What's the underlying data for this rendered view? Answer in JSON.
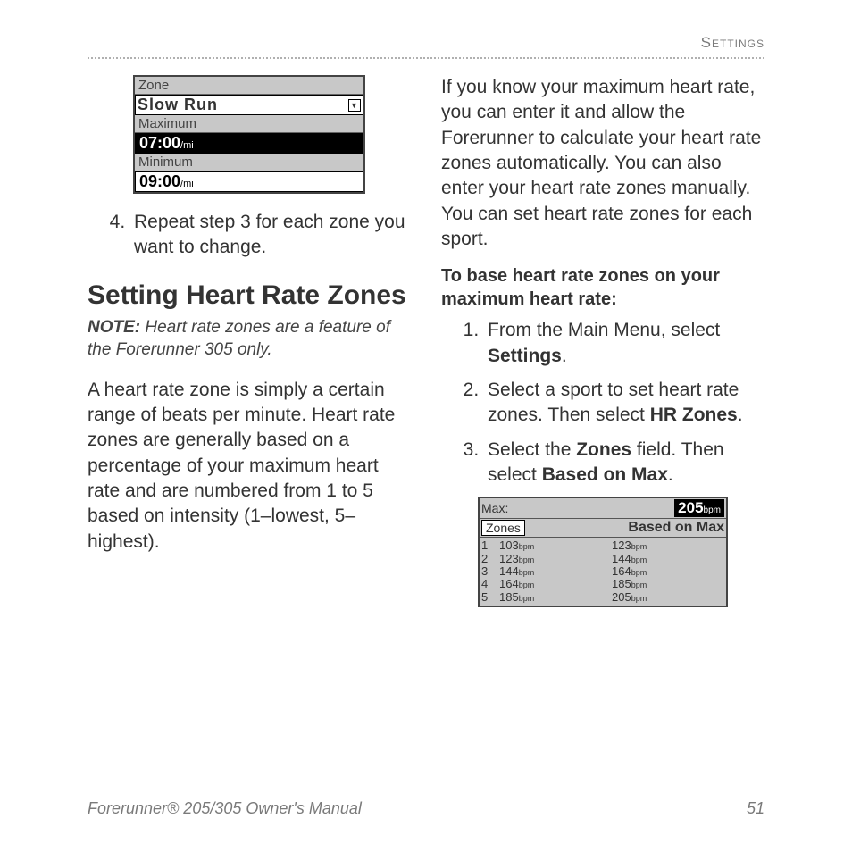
{
  "header": "Settings",
  "device1": {
    "zoneLabel": "Zone",
    "zoneValue": "Slow Run",
    "maxLabel": "Maximum",
    "maxValue": "07:00",
    "maxUnit": "/mi",
    "minLabel": "Minimum",
    "minValue": "09:00",
    "minUnit": "/mi"
  },
  "left": {
    "step4": "Repeat step 3 for each zone you want to change.",
    "heading": "Setting Heart Rate Zones",
    "noteLabel": "NOTE:",
    "noteText": " Heart rate zones are a feature of the Forerunner 305 only.",
    "para": "A heart rate zone is simply a certain range of beats per minute. Heart rate zones are generally based on a percentage of your maximum heart rate and are numbered from 1 to 5 based on intensity (1–lowest, 5–highest)."
  },
  "right": {
    "intro": "If you know your maximum heart rate, you can enter it and allow the Forerunner to calculate your heart rate zones automatically. You can also enter your heart rate zones manually. You can set heart rate zones for each sport.",
    "lead": "To base heart rate zones on your maximum heart rate:",
    "s1a": "From the Main Menu, select ",
    "s1b": "Settings",
    "s1c": ".",
    "s2a": "Select a sport to set heart rate zones. Then select ",
    "s2b": "HR Zones",
    "s2c": ".",
    "s3a": "Select the ",
    "s3b": "Zones",
    "s3c": " field. Then select ",
    "s3d": "Based on Max",
    "s3e": "."
  },
  "device2": {
    "maxLabel": "Max:",
    "maxValue": "205",
    "maxUnit": "bpm",
    "zonesLabel": "Zones",
    "basedLabel": "Based on Max",
    "rows": {
      "n1": "1",
      "n2": "2",
      "n3": "3",
      "n4": "4",
      "n5": "5",
      "l1": "103",
      "l2": "123",
      "l3": "144",
      "l4": "164",
      "l5": "185",
      "h1": "123",
      "h2": "144",
      "h3": "164",
      "h4": "185",
      "h5": "205",
      "unit": "bpm"
    }
  },
  "footer": {
    "left": "Forerunner® 205/305 Owner's Manual",
    "page": "51"
  }
}
